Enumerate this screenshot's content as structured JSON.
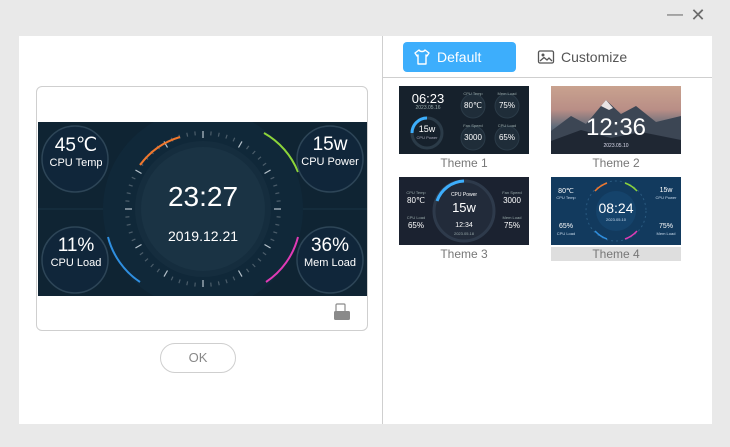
{
  "window": {
    "minimize_glyph": "—",
    "close_glyph": "✕"
  },
  "preview": {
    "time": "23:27",
    "date": "2019.12.21",
    "stats": [
      {
        "value": "45℃",
        "label": "CPU Temp"
      },
      {
        "value": "15w",
        "label": "CPU Power"
      },
      {
        "value": "11%",
        "label": "CPU Load"
      },
      {
        "value": "36%",
        "label": "Mem Load"
      }
    ],
    "accent_colors": [
      "#f0772d",
      "#8cd43a",
      "#2f8fe0",
      "#e03ab5"
    ],
    "screen_icon": "device-icon"
  },
  "ok_label": "OK",
  "tabs": [
    {
      "label": "Default",
      "icon": "tshirt-icon",
      "active": true
    },
    {
      "label": "Customize",
      "icon": "image-icon",
      "active": false
    }
  ],
  "themes": [
    {
      "name": "Theme 1",
      "time": "06:23",
      "date": "2023.05.16",
      "power_value": "15w",
      "power_label": "CPU Power",
      "gauges": [
        {
          "label": "CPU Temp",
          "value": "80℃"
        },
        {
          "label": "Mem Load",
          "value": "75%"
        },
        {
          "label": "Fan Speed",
          "value": "3000"
        },
        {
          "label": "CPU Load",
          "value": "65%"
        }
      ]
    },
    {
      "name": "Theme 2",
      "time": "12:36",
      "date": "2023.05.10"
    },
    {
      "name": "Theme 3",
      "center_label": "CPU Power",
      "center_value": "15w",
      "time": "12:34",
      "date": "2023.05.18",
      "side": [
        {
          "label": "CPU Temp",
          "value": "80℃"
        },
        {
          "label": "Fan Speed",
          "value": "3000"
        },
        {
          "label": "CPU Load",
          "value": "65%"
        },
        {
          "label": "Mem Load",
          "value": "75%"
        }
      ]
    },
    {
      "name": "Theme 4",
      "time": "08:24",
      "date": "2023.05.10",
      "side": [
        {
          "label": "CPU Temp",
          "value": "80℃"
        },
        {
          "label": "CPU Power",
          "value": "15w"
        },
        {
          "label": "CPU Load",
          "value": "65%"
        },
        {
          "label": "Mem Load",
          "value": "75%"
        }
      ],
      "selected": true
    }
  ]
}
